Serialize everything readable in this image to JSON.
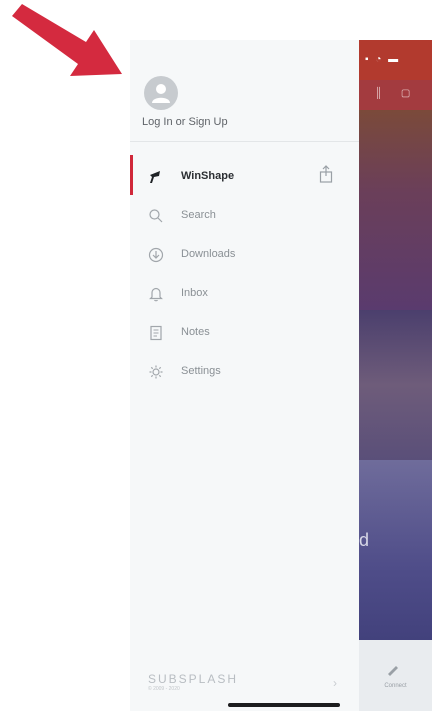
{
  "drawer": {
    "login_label": "Log In or Sign Up",
    "menu": [
      {
        "label": "WinShape",
        "icon": "megaphone-icon",
        "active": true
      },
      {
        "label": "Search",
        "icon": "search-icon",
        "active": false
      },
      {
        "label": "Downloads",
        "icon": "download-icon",
        "active": false
      },
      {
        "label": "Inbox",
        "icon": "bell-icon",
        "active": false
      },
      {
        "label": "Notes",
        "icon": "notes-icon",
        "active": false
      },
      {
        "label": "Settings",
        "icon": "gear-icon",
        "active": false
      }
    ],
    "brand": "SUBSPLASH",
    "brand_sub": "© 2009 - 2020"
  },
  "background": {
    "partial_letter": "d",
    "tab_label": "Connect"
  },
  "colors": {
    "accent": "#d0283a",
    "arrow": "#d42a3f"
  }
}
